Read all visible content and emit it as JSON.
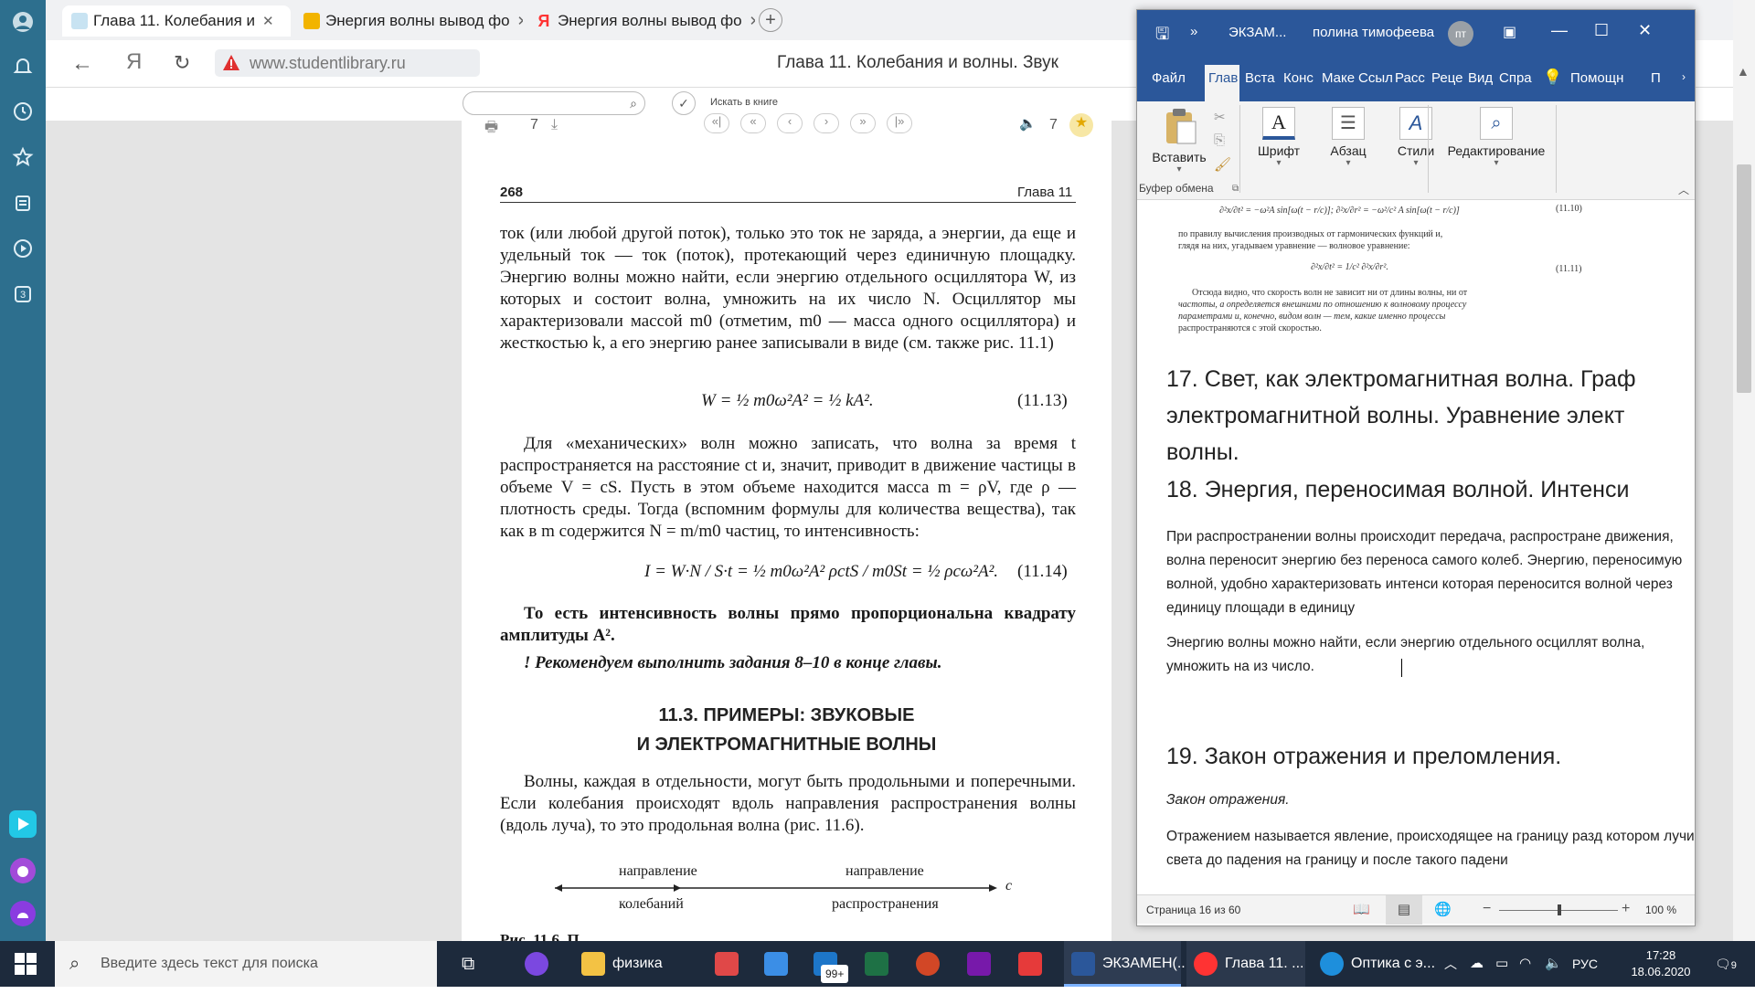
{
  "browser": {
    "tabs": [
      {
        "label": "Глава 11. Колебания и"
      },
      {
        "label": "Энергия волны вывод фо"
      },
      {
        "label": "Энергия волны вывод фо"
      }
    ],
    "url": "www.studentlibrary.ru",
    "page_title": "Глава 11. Колебания и волны. Звук",
    "search_placeholder": "",
    "search_in_book": "Искать в книге",
    "page_number_field": "7",
    "bookmarks_count": "7"
  },
  "book": {
    "page_no": "268",
    "chapter": "Глава 11",
    "para1": "ток (или любой другой поток), только это ток не заряда, а энергии, да еще и удельный ток — ток (поток), протекающий через единичную площадку. Энергию волны можно найти, если энергию отдельного осциллятора W, из которых и состоит волна, умножить на их число N. Осциллятор мы характеризовали массой m0 (отметим, m0 — масса одного осциллятора) и жесткостью k, а его энергию ранее записывали в виде (см. также рис. 11.1)",
    "eq1": "W = ½ m0ω²A² = ½ kA².",
    "eq1_no": "(11.13)",
    "para2": "Для «механических» волн можно записать, что волна за время t распространяется на расстояние ct и, значит, приводит в движение частицы в объеме V = cS. Пусть в этом объеме находится масса m = ρV, где ρ — плотность среды. Тогда (вспомним формулы для количества вещества), так как в m содержится N = m/m0 частиц, то интенсивность:",
    "eq2": "I = W·N / S·t = ½ m0ω²A² ρctS / m0St = ½ ρcω²A².",
    "eq2_no": "(11.14)",
    "para3": "То есть интенсивность волны прямо пропорциональна квадрату амплитуды A².",
    "para4": "! Рекомендуем выполнить задания 8–10 в конце главы.",
    "section_title_1": "11.3. ПРИМЕРЫ: ЗВУКОВЫЕ",
    "section_title_2": "И ЭЛЕКТРОМАГНИТНЫЕ ВОЛНЫ",
    "para5": "Волны, каждая в отдельности, могут быть продольными и поперечными. Если колебания происходят вдоль направления распространения волны (вдоль луча), то это продольная волна (рис. 11.6).",
    "fig_top_left": "направление",
    "fig_bottom_left": "колебаний",
    "fig_top_right": "направление",
    "fig_bottom_right": "распространения",
    "fig_c": "c",
    "fig_caption_partial": "Рис. 11.6. П"
  },
  "word": {
    "doc_title": "ЭКЗАМ...",
    "user": "полина тимофеева",
    "user_initials": "пт",
    "tabs": [
      "Файл",
      "Глав",
      "Вста",
      "Конс",
      "Маке",
      "Ссыл",
      "Расс",
      "Реце",
      "Вид",
      "Спра"
    ],
    "help": "Помощн",
    "share": "П",
    "ribbon": {
      "paste": "Вставить",
      "clipboard": "Буфер обмена",
      "font": "Шрифт",
      "paragraph": "Абзац",
      "styles": "Стили",
      "editing": "Редактирование"
    },
    "scan_lines": [
      "по правилу вычисления производных от гармонических функций и,",
      "глядя на них, угадываем уравнение — волновое уравнение:",
      "Отсюда видно, что скорость волн не зависит ни от длины волны, ни от",
      "частоты, а определяется внешними по отношению к волновому процессу",
      "параметрами и, конечно, видом волн — тем, какие именно процессы",
      "распространяются с этой скоростью."
    ],
    "scan_eq_no1": "(11.10)",
    "scan_eq_no2": "(11.11)",
    "h17": "17. Свет, как электромагнитная волна. Граф электромагнитной волны. Уравнение элект волны.",
    "h18": "18. Энергия, переносимая волной. Интенси",
    "p18a": "При распространении волны происходит передача, распростране движения, волна переносит энергию без переноса самого колеб. Энергию, переносимую волной, удобно характеризовать интенси которая переносится волной через единицу площади в единицу",
    "p18b": "Энергию волны можно найти, если энергию отдельного осциллят волна, умножить на из число.",
    "h19": "19. Закон отражения и преломления.",
    "p19_italic": "Закон отражения.",
    "p19": "Отражением называется явление, происходящее на границу разд котором лучи света до падения на границу и после такого падени",
    "status_page": "Страница 16 из 60",
    "zoom": "100 %"
  },
  "taskbar": {
    "search": "Введите здесь текст для поиска",
    "folder": "физика",
    "badge": "99+",
    "word": "ЭКЗАМЕН(...",
    "yandex": "Глава 11. ...",
    "edge": "Оптика с э...",
    "lang": "РУС",
    "time": "17:28",
    "date": "18.06.2020",
    "notif": "9"
  },
  "colors": {
    "word_blue": "#2b579a",
    "browser_sidebar": "#2d6f8e",
    "taskbar": "#1d2a3c"
  }
}
